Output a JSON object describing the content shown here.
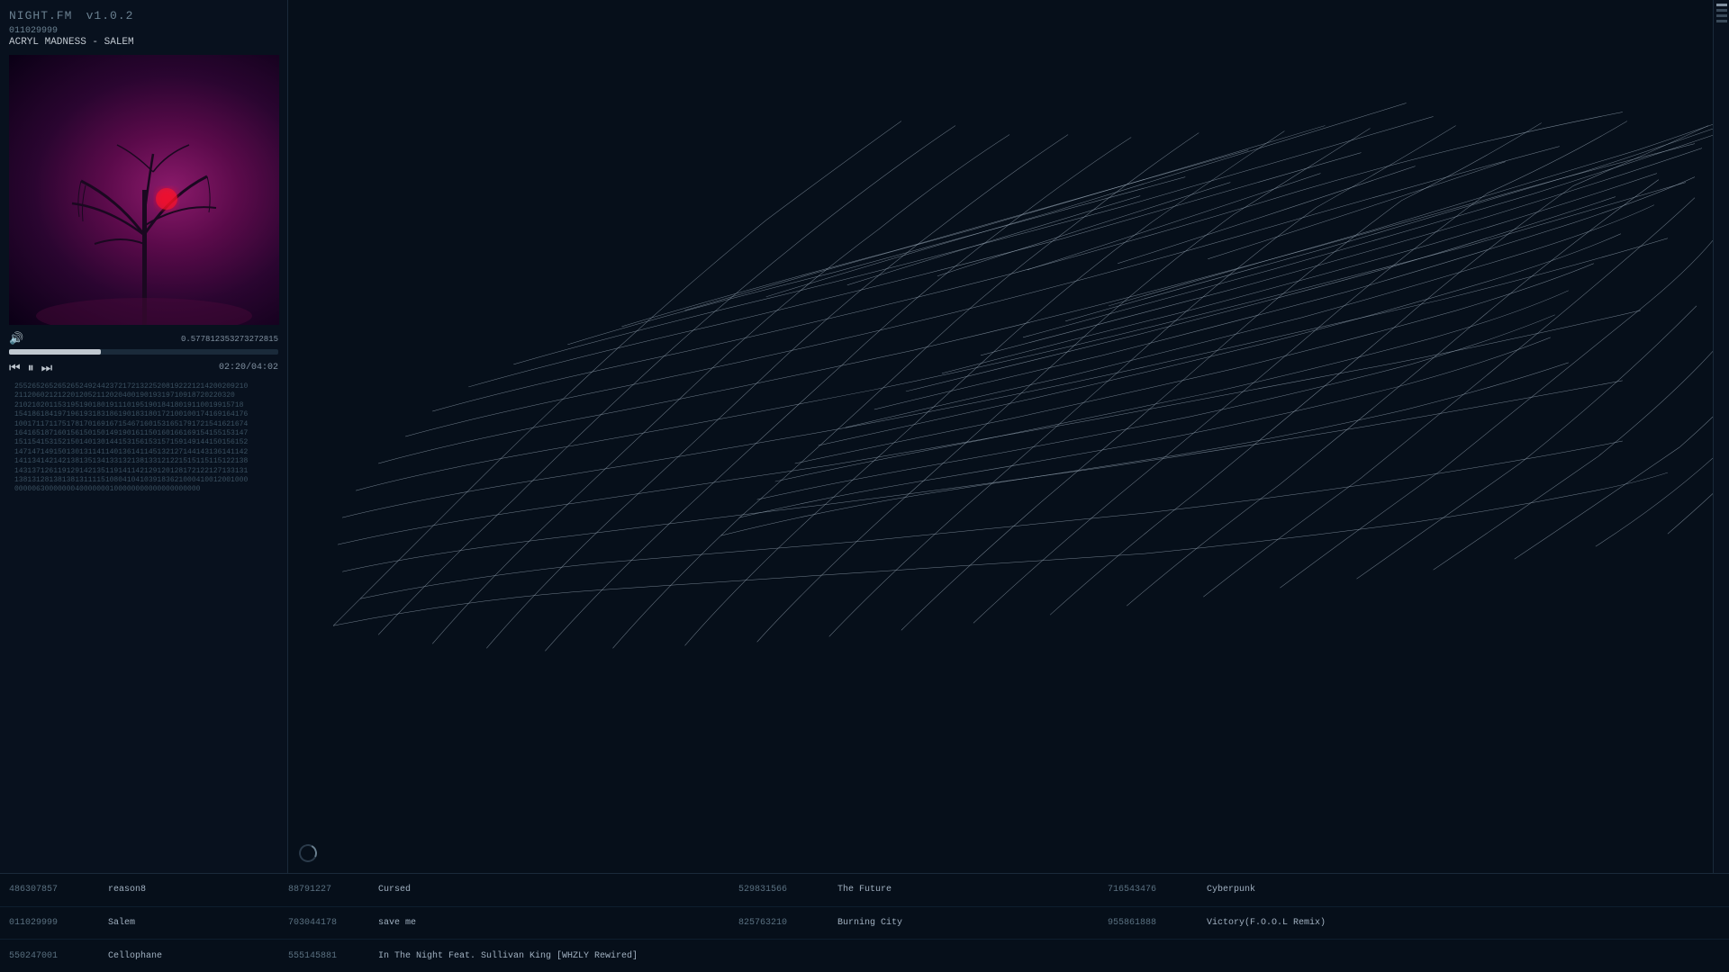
{
  "app": {
    "title": "NIGHT.FM",
    "version": "v1.0.2"
  },
  "player": {
    "track_id": "011029999",
    "track_name": "ACRYL MADNESS - SALEM",
    "volume_icon": "🔊",
    "progress_value": "0.577812353273272815",
    "progress_percent": 34,
    "time_current": "02:20",
    "time_total": "04:02",
    "btn_prev": "⏮",
    "btn_play": "⏸",
    "btn_next": "⏭"
  },
  "code_matrix": "255265265265265249244237217213225208192221214200209210\n211206021212201205211202040019019319710918720220320\n21021020115319519018019111019519018418019110019915718\n154186184197196193183186190183180172100100174169164176\n100171171175178170169167154671601531651791721541621674\n164165187160156150150149190161150160166169154155153147\n151154153152150140130144153156153157159149144150156152\n147147149150130131141140136141145132127144143136141142\n141134142142138135134133132138133121221515115115122138\n143137126119129142135119141142129120128172122127133131\n138131281381381311115108041041039183621000410012001000\n0000063000000040000000100000000000000000000",
  "bottom_tracks": [
    {
      "id1": "486307857",
      "artist1": "reason8",
      "id2": "88791227",
      "track2": "Cursed",
      "id3": "529831566",
      "track3": "The Future",
      "id4": "716543476",
      "track4": "Cyberpunk"
    },
    {
      "id1": "011029999",
      "artist1": "Salem",
      "id2": "703044178",
      "track2": "save me",
      "id3": "825763210",
      "track3": "Burning City",
      "id4": "955861888",
      "track4": "Victory(F.O.O.L Remix)"
    },
    {
      "id1": "550247001",
      "artist1": "Cellophane",
      "id2": "555145881",
      "track2": "In The Night Feat. Sullivan King [WHZLY Rewired]",
      "id3": "",
      "track3": "",
      "id4": "",
      "track4": ""
    }
  ],
  "scrollbar": {
    "ticks": [
      true,
      false,
      false,
      false
    ]
  }
}
